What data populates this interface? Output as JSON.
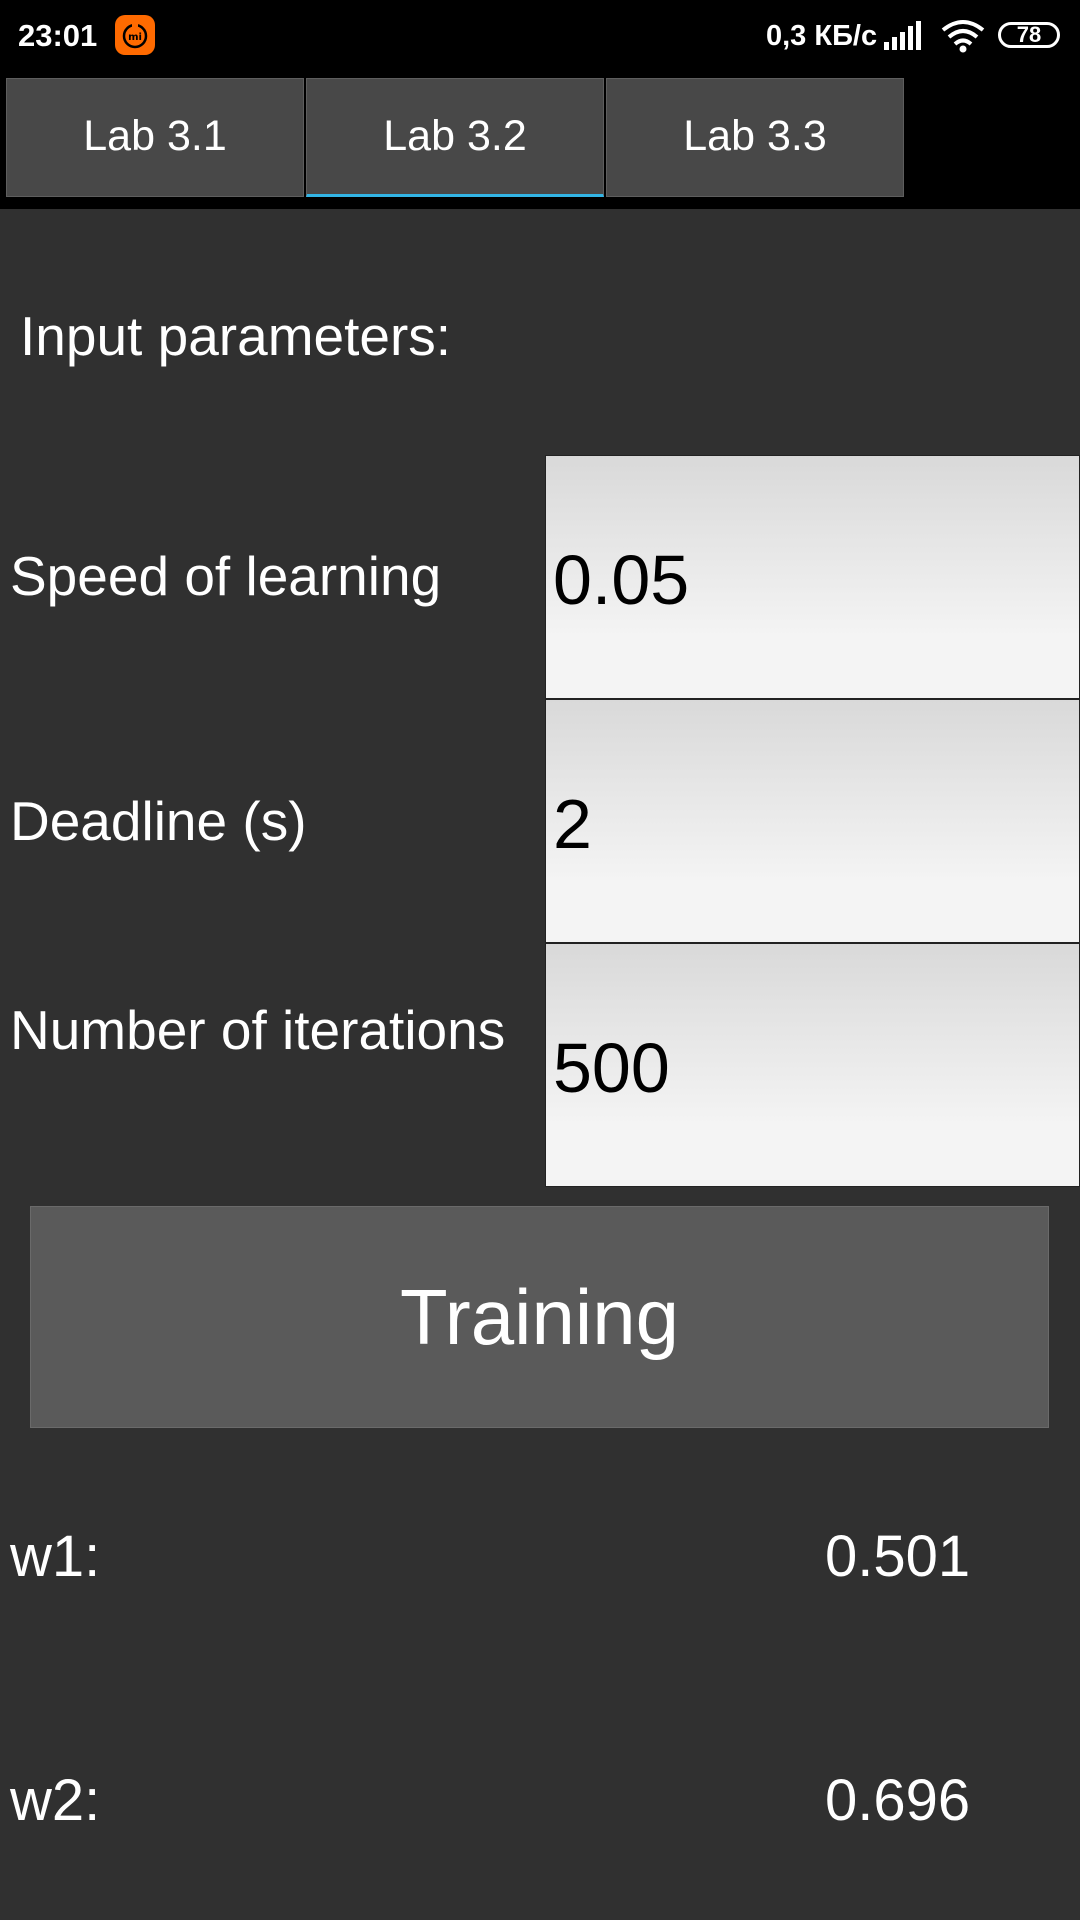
{
  "status_bar": {
    "time": "23:01",
    "net_speed": "0,3 КБ/с",
    "battery": "78",
    "icons": [
      "mi-icon",
      "signal-icon",
      "wifi-icon",
      "battery-icon"
    ]
  },
  "tabs": [
    {
      "label": "Lab 3.1",
      "active": false
    },
    {
      "label": "Lab 3.2",
      "active": true
    },
    {
      "label": "Lab 3.3",
      "active": false
    }
  ],
  "form": {
    "title": "Input parameters:",
    "fields": [
      {
        "label": "Speed of learning",
        "value": "0.05"
      },
      {
        "label": "Deadline (s)",
        "value": "2"
      },
      {
        "label": "Number of iterations",
        "value": "500"
      }
    ],
    "button_label": "Training"
  },
  "results": [
    {
      "label": "w1:",
      "value": "0.501"
    },
    {
      "label": "w2:",
      "value": "0.696"
    }
  ],
  "colors": {
    "background": "#303030",
    "tab_background": "#484848",
    "tab_active_indicator": "#33b5e5",
    "button_background": "#5a5a5a",
    "mi_icon": "#ff6a00"
  }
}
